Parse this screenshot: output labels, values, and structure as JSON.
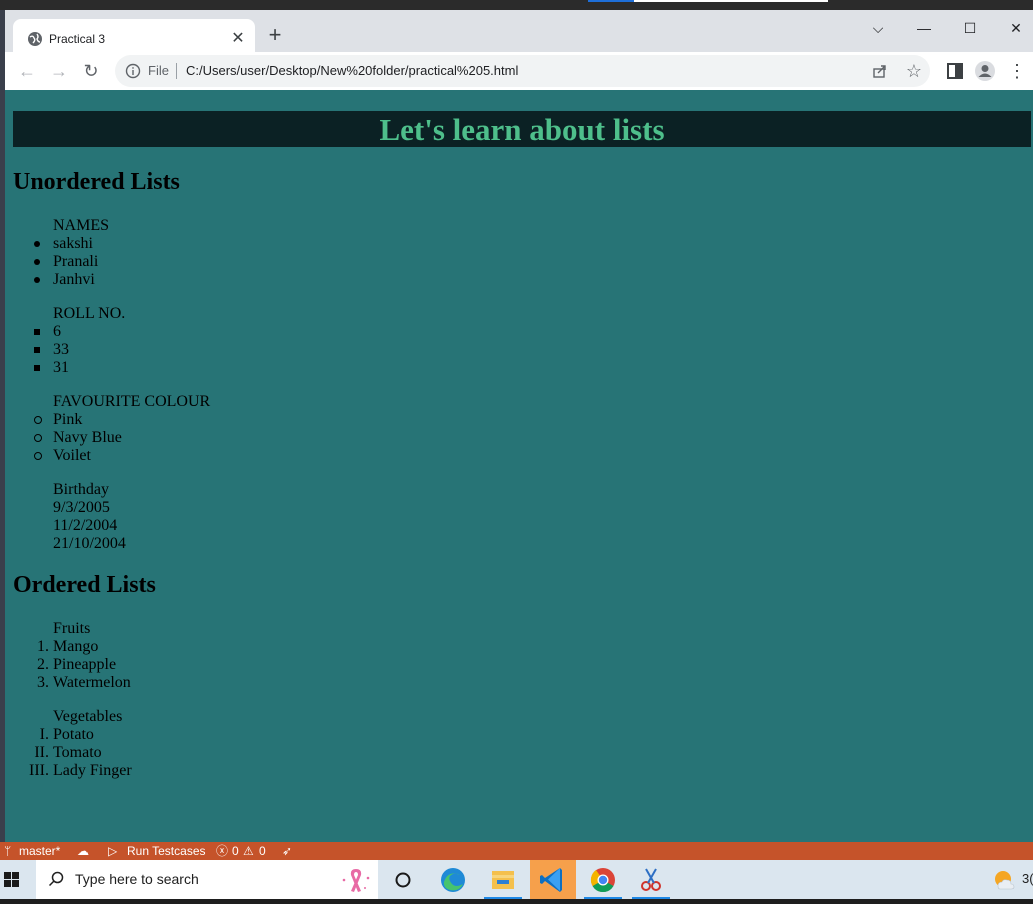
{
  "browser": {
    "tab_title": "Practical 3",
    "tab_close": "✕",
    "new_tab": "+",
    "window_controls": {
      "dropdown": "⌵",
      "minimize": "—",
      "maximize": "☐",
      "close": "✕"
    },
    "file_label": "File",
    "url": "C:/Users/user/Desktop/New%20folder/practical%205.html"
  },
  "page": {
    "banner": "Let's learn about lists",
    "unordered_heading": "Unordered Lists",
    "unordered_lists": [
      {
        "header": "NAMES",
        "style": "disc",
        "items": [
          "sakshi",
          "Pranali",
          "Janhvi"
        ]
      },
      {
        "header": "ROLL NO.",
        "style": "square",
        "items": [
          "6",
          "33",
          "31"
        ]
      },
      {
        "header": "FAVOURITE COLOUR",
        "style": "circle",
        "items": [
          "Pink",
          "Navy Blue",
          "Voilet"
        ]
      },
      {
        "header": "Birthday",
        "style": "none",
        "items": [
          "9/3/2005",
          "11/2/2004",
          "21/10/2004"
        ]
      }
    ],
    "ordered_heading": "Ordered Lists",
    "ordered_lists": [
      {
        "header": "Fruits",
        "markers": [
          "1.",
          "2.",
          "3."
        ],
        "items": [
          "Mango",
          "Pineapple",
          "Watermelon"
        ]
      },
      {
        "header": "Vegetables",
        "markers": [
          "I.",
          "II.",
          "III."
        ],
        "items": [
          "Potato",
          "Tomato",
          "Lady Finger"
        ]
      }
    ]
  },
  "statusbar": {
    "branch": "master*",
    "run": "Run Testcases",
    "errors": "0",
    "warnings": "0"
  },
  "taskbar": {
    "search_placeholder": "Type here to search",
    "weather_text": "3("
  },
  "colors": {
    "page_bg": "#277476",
    "banner_bg": "#0b2124",
    "banner_text": "#4ebf8b",
    "status_bar": "#c5532a"
  }
}
